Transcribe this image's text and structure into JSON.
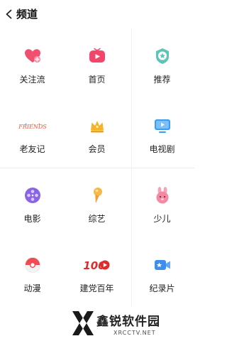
{
  "header": {
    "title": "频道"
  },
  "channels": [
    {
      "label": "关注流",
      "icon": "heart-plus-icon"
    },
    {
      "label": "首页",
      "icon": "play-tv-icon"
    },
    {
      "label": "推荐",
      "icon": "star-badge-icon"
    },
    {
      "label": "老友记",
      "icon": "friends-logo-icon",
      "logo_text": "FRIENDS"
    },
    {
      "label": "会员",
      "icon": "crown-icon"
    },
    {
      "label": "电视剧",
      "icon": "tv-play-icon"
    },
    {
      "label": "电影",
      "icon": "film-reel-icon"
    },
    {
      "label": "综艺",
      "icon": "microphone-icon"
    },
    {
      "label": "少儿",
      "icon": "bunny-icon"
    },
    {
      "label": "动漫",
      "icon": "pokeball-icon"
    },
    {
      "label": "建党百年",
      "icon": "centenary-100-icon",
      "logo_text": "100"
    },
    {
      "label": "纪录片",
      "icon": "camera-icon"
    }
  ],
  "watermark": {
    "text": "鑫锐软件园",
    "sub": "XRCCTV.NET"
  }
}
